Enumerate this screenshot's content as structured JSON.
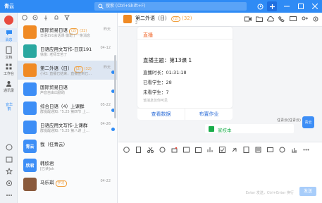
{
  "app": {
    "title": "青云"
  },
  "search": {
    "placeholder": "搜索 (Ctrl+Shift+F)"
  },
  "nav": {
    "items": [
      {
        "label": "消息",
        "icon": "chat-bubble-icon"
      },
      {
        "label": "文档",
        "icon": "document-icon"
      },
      {
        "label": "工作台",
        "icon": "grid-icon"
      },
      {
        "label": "通讯录",
        "icon": "contacts-icon"
      }
    ],
    "badge": "宜华鹤"
  },
  "conversations": [
    {
      "name": "国际贸易日语",
      "tag": "(2)",
      "tag2": "(32)",
      "time": "昨天",
      "snippet": "日语191会话课 徽斑了一条消息",
      "avatar_color": "#f08a24",
      "avatar_text": "",
      "unread": false
    },
    {
      "name": "日语应用文写作-日双191",
      "tag": "",
      "tag2": "",
      "time": "04-12",
      "snippet": "徐俊: 老师辛苦了",
      "avatar_color": "#2aa8a0",
      "avatar_text": "",
      "unread": false
    },
    {
      "name": "第二外语（日）",
      "tag": "(2)",
      "tag2": "(32)",
      "time": "昨天",
      "snippet": "小红: 直播已结束，直播签到已…",
      "avatar_color": "#f08a24",
      "avatar_text": "",
      "unread": true,
      "active": true
    },
    {
      "name": "国际贸易日语",
      "tag": "",
      "tag2": "",
      "time": "",
      "snippet": "声音自由出勤助",
      "avatar_color": "#3d8ef6",
      "avatar_text": "",
      "unread": true
    },
    {
      "name": "综合日语（4）上课群",
      "tag": "",
      "tag2": "",
      "time": "05-22",
      "snippet": "群提醒通知: \"5.25 第四节 上…",
      "avatar_color": "#3d8ef6",
      "avatar_text": "",
      "unread": true
    },
    {
      "name": "日语应用文写作-上课群",
      "tag": "",
      "tag2": "",
      "time": "04-26",
      "snippet": "群提醒通知: \"5.25 第八讲 上…",
      "avatar_color": "#3d8ef6",
      "avatar_text": "",
      "unread": true
    },
    {
      "name": "我（任青云）",
      "tag": "",
      "tag2": "",
      "time": "",
      "snippet": "",
      "avatar_color": "#3d8ef6",
      "avatar_text": "青云",
      "unread": false
    },
    {
      "name": "韩欣君",
      "tag": "",
      "tag2": "",
      "time": "",
      "snippet": "[已读]ok",
      "avatar_color": "#3d8ef6",
      "avatar_text": "欣君",
      "unread": false
    },
    {
      "name": "马乐琪",
      "tag": "学习",
      "tag2": "",
      "time": "04-22",
      "snippet": "",
      "avatar_color": "#8a5a3c",
      "avatar_text": "",
      "unread": false
    }
  ],
  "chat": {
    "title": "第二外语（日）",
    "tag": "(2)",
    "tag2": "(32)",
    "subtitle": "2",
    "card": {
      "header": "直播",
      "theme": "直播主题：第13课 1",
      "rows": [
        {
          "label": "直播时长：01:31:18"
        },
        {
          "label": "已看学生：28"
        },
        {
          "label": "未看学生：7"
        }
      ],
      "note": "该消息仅你可见",
      "btn_view": "查看数据",
      "btn_hw": "布置作业"
    },
    "sender": "任青云(任青云)",
    "sender_avatar": "青云",
    "file_name": "家校本",
    "input_hint": "Enter 发送，Ctrl+Enter 换行",
    "send": "发送"
  },
  "colors": {
    "brand": "#2f8bf5",
    "orange": "#f08a24",
    "green": "#1aad4b"
  }
}
